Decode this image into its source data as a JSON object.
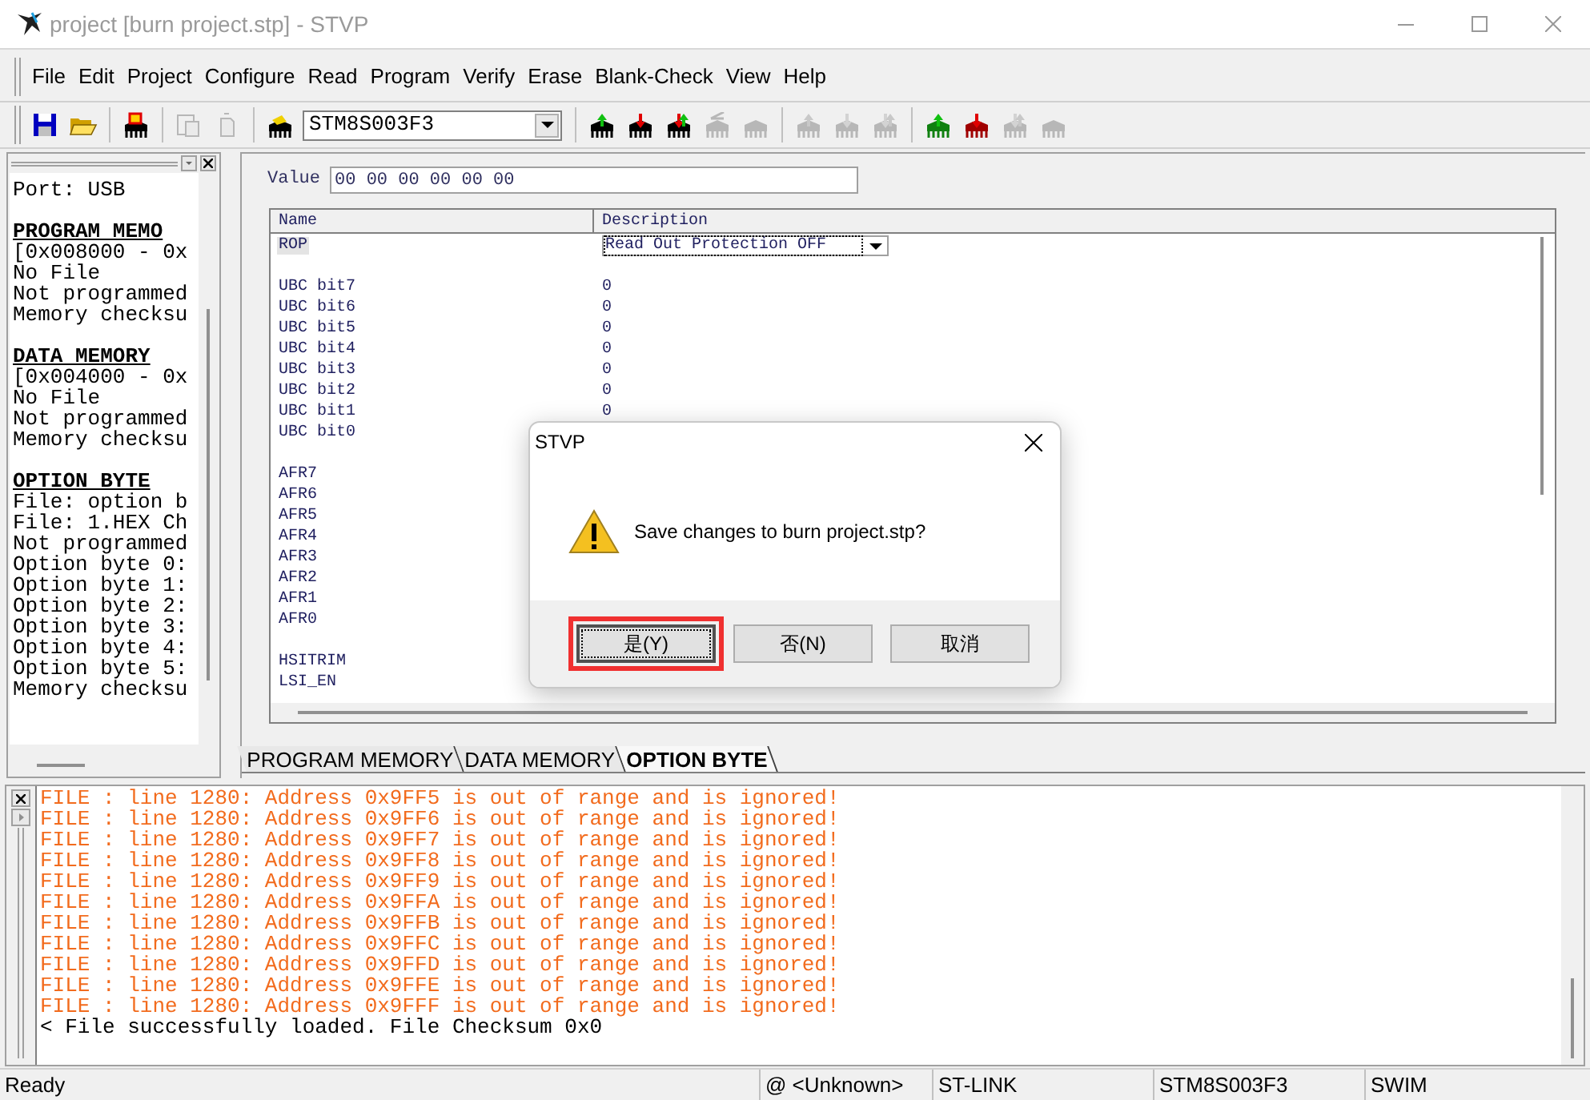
{
  "window": {
    "title": "project [burn project.stp] - STVP"
  },
  "menu": [
    {
      "label": "File"
    },
    {
      "label": "Edit"
    },
    {
      "label": "Project"
    },
    {
      "label": "Configure"
    },
    {
      "label": "Read"
    },
    {
      "label": "Program"
    },
    {
      "label": "Verify"
    },
    {
      "label": "Erase"
    },
    {
      "label": "Blank-Check"
    },
    {
      "label": "View"
    },
    {
      "label": "Help"
    }
  ],
  "toolbar": [
    {
      "items": [
        {
          "kind": "save",
          "disabled": false
        },
        {
          "kind": "open",
          "disabled": false
        }
      ]
    },
    {
      "items": [
        {
          "kind": "project",
          "disabled": false
        }
      ]
    },
    {
      "items": [
        {
          "kind": "paste",
          "disabled": true
        },
        {
          "kind": "document",
          "disabled": true
        }
      ]
    },
    {
      "items": [
        {
          "kind": "device",
          "disabled": false
        },
        {
          "kind": "select",
          "value": "STM8S003F3"
        }
      ]
    },
    {
      "items": [
        {
          "kind": "read",
          "disabled": false
        },
        {
          "kind": "program",
          "disabled": false
        },
        {
          "kind": "verify",
          "disabled": false
        },
        {
          "kind": "erase",
          "disabled": true
        },
        {
          "kind": "blank",
          "disabled": true
        }
      ]
    },
    {
      "items": [
        {
          "kind": "read",
          "disabled": true
        },
        {
          "kind": "program",
          "disabled": true
        },
        {
          "kind": "verify",
          "disabled": true
        }
      ]
    },
    {
      "items": [
        {
          "kind": "read-all",
          "disabled": false
        },
        {
          "kind": "program-all",
          "disabled": false
        },
        {
          "kind": "verify",
          "disabled": true
        },
        {
          "kind": "blank",
          "disabled": true
        }
      ]
    }
  ],
  "left_panel": {
    "sections": [
      {
        "lines": [
          "Port: USB"
        ]
      },
      {
        "heading": "PROGRAM MEMO",
        "lines": [
          "[0x008000 - 0x",
          "No File",
          "Not programmed",
          "Memory checksu"
        ]
      },
      {
        "heading": "DATA MEMORY",
        "lines": [
          "[0x004000 - 0x",
          "No File",
          "Not programmed",
          "Memory checksu"
        ]
      },
      {
        "heading": "OPTION BYTE",
        "lines": [
          "File: option b",
          "File: 1.HEX Ch",
          "Not programmed",
          "Option byte 0:",
          "Option byte 1:",
          "Option byte 2:",
          "Option byte 3:",
          "Option byte 4:",
          "Option byte 5:",
          "Memory checksu"
        ]
      }
    ]
  },
  "value_field": {
    "label": "Value",
    "value": "00 00 00 00 00 00"
  },
  "table": {
    "columns": [
      "Name",
      "Description"
    ],
    "groups": [
      {
        "rows": [
          {
            "name": "ROP",
            "select": {
              "value": "Read Out Protection OFF"
            },
            "selected": true
          }
        ]
      },
      {
        "rows": [
          {
            "name": "UBC bit7",
            "value": "0",
            "selected": false
          },
          {
            "name": "UBC bit6",
            "value": "0",
            "selected": false
          },
          {
            "name": "UBC bit5",
            "value": "0",
            "selected": false
          },
          {
            "name": "UBC bit4",
            "value": "0",
            "selected": false
          },
          {
            "name": "UBC bit3",
            "value": "0",
            "selected": false
          },
          {
            "name": "UBC bit2",
            "value": "0",
            "selected": false
          },
          {
            "name": "UBC bit1",
            "value": "0",
            "selected": false
          },
          {
            "name": "UBC bit0",
            "selected": false
          }
        ]
      },
      {
        "rows": [
          {
            "name": "AFR7",
            "selected": false
          },
          {
            "name": "AFR6",
            "selected": false
          },
          {
            "name": "AFR5",
            "selected": false
          },
          {
            "name": "AFR4",
            "selected": false
          },
          {
            "name": "AFR3",
            "selected": false
          },
          {
            "name": "AFR2",
            "selected": false
          },
          {
            "name": "AFR1",
            "selected": false
          },
          {
            "name": "AFR0",
            "selected": false
          }
        ]
      },
      {
        "rows": [
          {
            "name": "HSITRIM",
            "selected": false
          },
          {
            "name": "LSI_EN",
            "selected": false
          }
        ]
      }
    ]
  },
  "tabs": [
    {
      "label": "PROGRAM MEMORY",
      "selected": false
    },
    {
      "label": "DATA MEMORY",
      "selected": false
    },
    {
      "label": "OPTION BYTE",
      "selected": true
    }
  ],
  "dialog": {
    "title": "STVP",
    "message": "Save changes to burn project.stp?",
    "buttons": [
      {
        "label": "是(Y)",
        "selected": true
      },
      {
        "label": "否(N)",
        "selected": false
      },
      {
        "label": "取消",
        "selected": false
      }
    ]
  },
  "log": [
    {
      "kind": "error",
      "text": "FILE : line 1280: Address 0x9FF5 is out of range and is ignored!"
    },
    {
      "kind": "error",
      "text": "FILE : line 1280: Address 0x9FF6 is out of range and is ignored!"
    },
    {
      "kind": "error",
      "text": "FILE : line 1280: Address 0x9FF7 is out of range and is ignored!"
    },
    {
      "kind": "error",
      "text": "FILE : line 1280: Address 0x9FF8 is out of range and is ignored!"
    },
    {
      "kind": "error",
      "text": "FILE : line 1280: Address 0x9FF9 is out of range and is ignored!"
    },
    {
      "kind": "error",
      "text": "FILE : line 1280: Address 0x9FFA is out of range and is ignored!"
    },
    {
      "kind": "error",
      "text": "FILE : line 1280: Address 0x9FFB is out of range and is ignored!"
    },
    {
      "kind": "error",
      "text": "FILE : line 1280: Address 0x9FFC is out of range and is ignored!"
    },
    {
      "kind": "error",
      "text": "FILE : line 1280: Address 0x9FFD is out of range and is ignored!"
    },
    {
      "kind": "error",
      "text": "FILE : line 1280: Address 0x9FFE is out of range and is ignored!"
    },
    {
      "kind": "error",
      "text": "FILE : line 1280: Address 0x9FFF is out of range and is ignored!"
    },
    {
      "kind": "info",
      "text": "< File successfully loaded. File Checksum 0x0"
    }
  ],
  "status_bar": [
    "Ready",
    "@ <Unknown>",
    "ST-LINK",
    "STM8S003F3",
    "SWIM"
  ]
}
